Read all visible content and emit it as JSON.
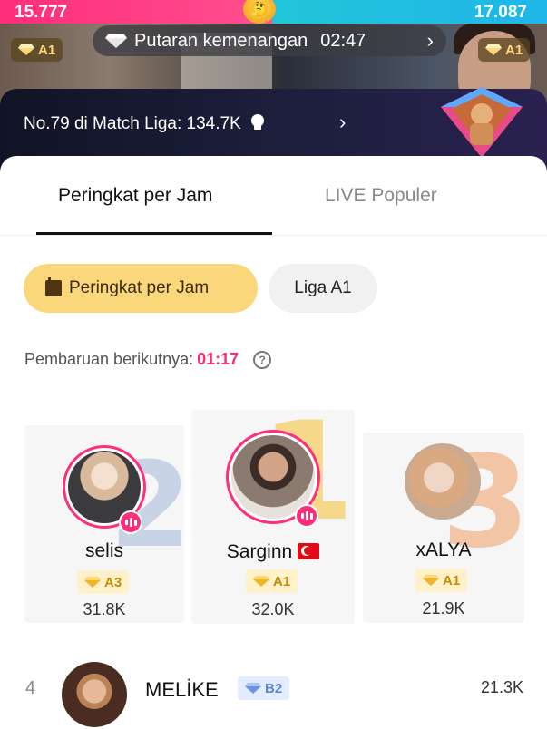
{
  "battle": {
    "left_score": "15.777",
    "right_score": "17.087",
    "left_league": "A1",
    "right_league": "A1",
    "round_label": "Putaran kemenangan",
    "round_timer": "02:47",
    "colors": {
      "left": "#ff2d7a",
      "right": "#21c5d8"
    }
  },
  "banner": {
    "text": "No.79 di Match Liga: 134.7K",
    "icon": "boxing-glove-icon"
  },
  "tabs": [
    {
      "label": "Peringkat per Jam",
      "active": true
    },
    {
      "label": "LIVE Populer",
      "active": false
    }
  ],
  "filters": [
    {
      "label": "Peringkat per Jam",
      "selected": true,
      "icon": "calendar-icon"
    },
    {
      "label": "Liga A1",
      "selected": false
    }
  ],
  "update": {
    "label": "Pembaruan berikutnya:",
    "time": "01:17"
  },
  "podium": [
    {
      "rank": "2",
      "name": "selis",
      "league": "A3",
      "score": "31.8K",
      "live": true
    },
    {
      "rank": "1",
      "name": "Sarginn",
      "league": "A1",
      "score": "32.0K",
      "live": true,
      "flag": "turkey-flag-icon"
    },
    {
      "rank": "3",
      "name": "xALYA",
      "league": "A1",
      "score": "21.9K",
      "live": false
    }
  ],
  "list": [
    {
      "rank": "4",
      "name": "MELİKE",
      "league": "B2",
      "score": "21.3K"
    }
  ],
  "accent": {
    "pink": "#ff2d6b",
    "gold": "#fbd77c"
  }
}
